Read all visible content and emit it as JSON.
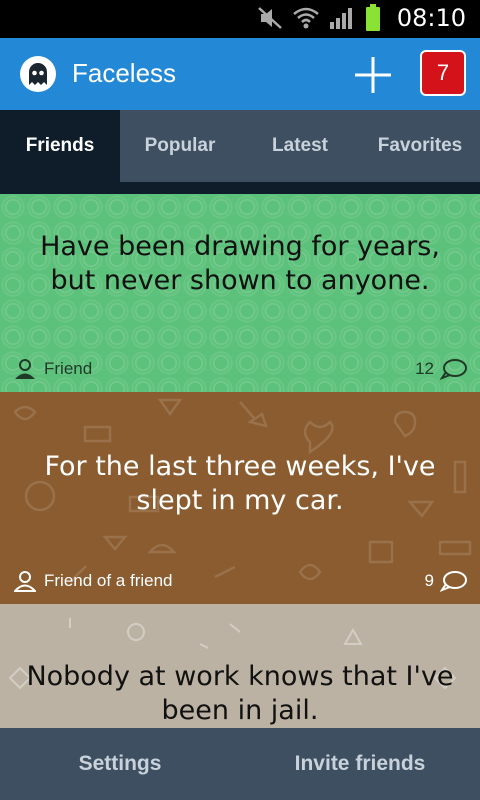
{
  "status_bar": {
    "time": "08:10"
  },
  "app_bar": {
    "title": "Faceless",
    "notification_count": "7"
  },
  "tabs": [
    {
      "label": "Friends",
      "active": true
    },
    {
      "label": "Popular",
      "active": false
    },
    {
      "label": "Latest",
      "active": false
    },
    {
      "label": "Favorites",
      "active": false
    }
  ],
  "posts": [
    {
      "text": "Have been drawing for years, but never shown to anyone.",
      "author": "Friend",
      "comments": "12",
      "background": "#5cc17a"
    },
    {
      "text": "For the last three weeks, I've slept in my car.",
      "author": "Friend of a friend",
      "comments": "9",
      "background": "#8a5c30"
    },
    {
      "text": "Nobody at work knows that I've been in jail.",
      "background": "#bcb2a3"
    }
  ],
  "bottom_bar": {
    "settings_label": "Settings",
    "invite_label": "Invite friends"
  },
  "colors": {
    "app_bar": "#2389d6",
    "tab_bar": "#3d4f61",
    "active_tab": "#0f1c2a",
    "badge": "#d3121a"
  }
}
